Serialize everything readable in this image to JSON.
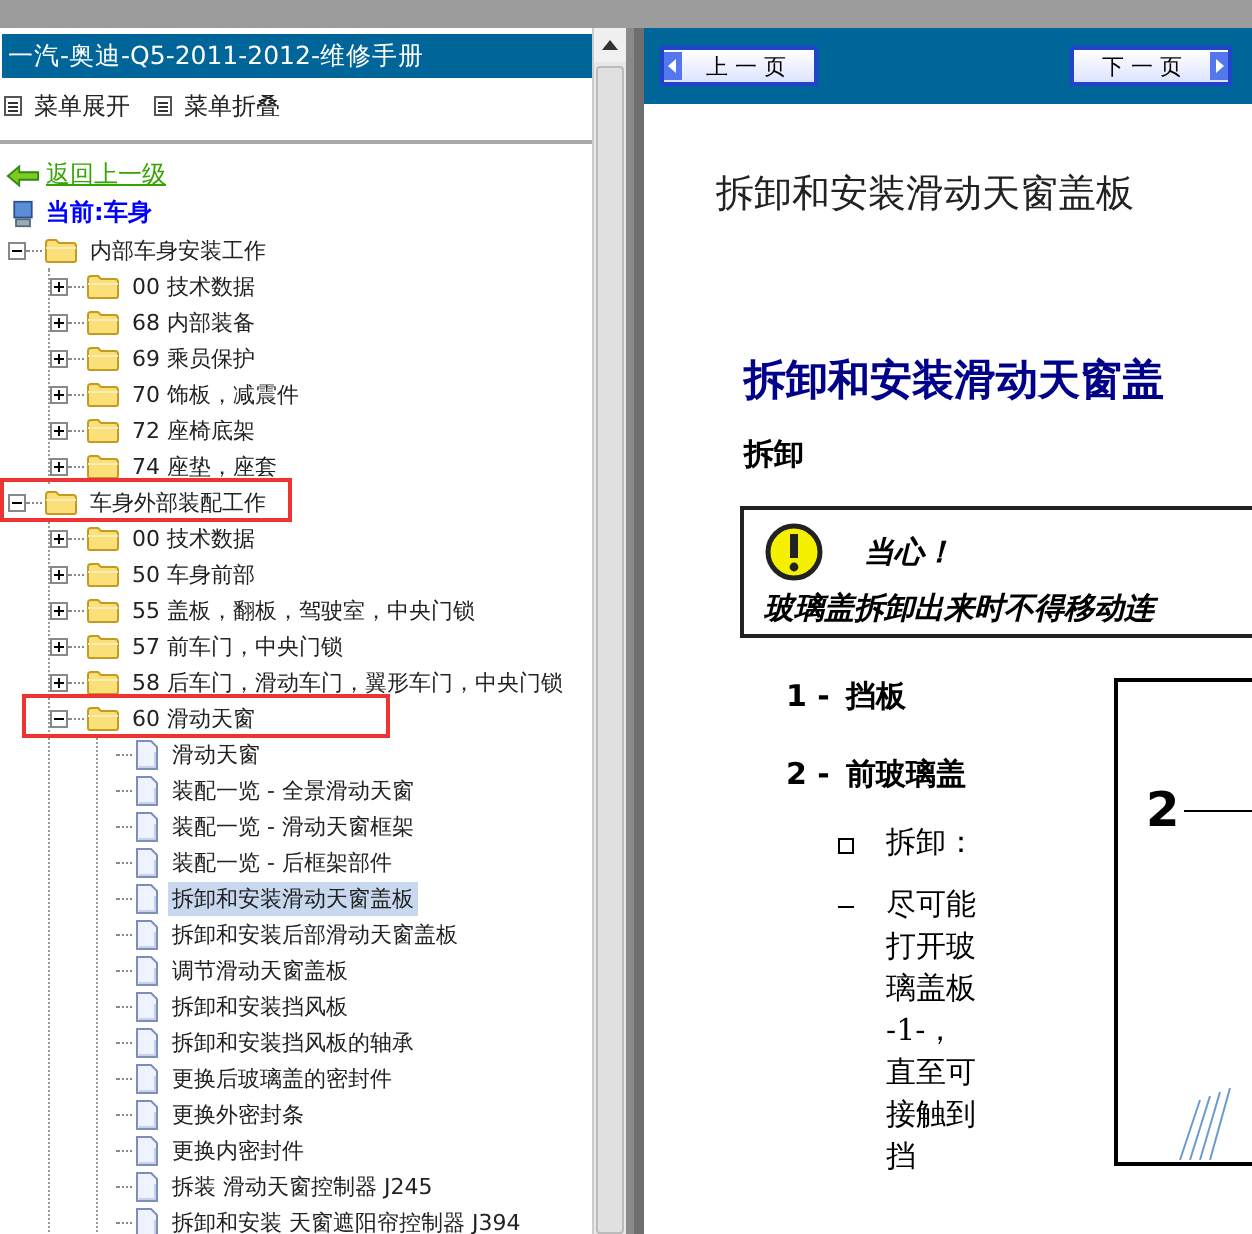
{
  "left_pane": {
    "title": "一汽-奥迪-Q5-2011-2012-维修手册",
    "menu_buttons": [
      "菜单展开",
      "菜单折叠"
    ],
    "back_link": "返回上一级",
    "current": "当前:车身",
    "tree": [
      {
        "label": "内部车身安装工作",
        "kind": "folder",
        "expanded": true,
        "selected": false,
        "annotated": false,
        "children": [
          {
            "label": "00 技术数据",
            "kind": "folder",
            "expanded": false,
            "selected": false,
            "annotated": false
          },
          {
            "label": "68 内部装备",
            "kind": "folder",
            "expanded": false,
            "selected": false,
            "annotated": false
          },
          {
            "label": "69 乘员保护",
            "kind": "folder",
            "expanded": false,
            "selected": false,
            "annotated": false
          },
          {
            "label": "70 饰板，减震件",
            "kind": "folder",
            "expanded": false,
            "selected": false,
            "annotated": false
          },
          {
            "label": "72 座椅底架",
            "kind": "folder",
            "expanded": false,
            "selected": false,
            "annotated": false
          },
          {
            "label": "74 座垫，座套",
            "kind": "folder",
            "expanded": false,
            "selected": false,
            "annotated": false
          }
        ]
      },
      {
        "label": "车身外部装配工作",
        "kind": "folder",
        "expanded": true,
        "selected": false,
        "annotated": true,
        "children": [
          {
            "label": "00 技术数据",
            "kind": "folder",
            "expanded": false,
            "selected": false,
            "annotated": false
          },
          {
            "label": "50 车身前部",
            "kind": "folder",
            "expanded": false,
            "selected": false,
            "annotated": false
          },
          {
            "label": "55 盖板，翻板，驾驶室，中央门锁",
            "kind": "folder",
            "expanded": false,
            "selected": false,
            "annotated": false
          },
          {
            "label": "57 前车门，中央门锁",
            "kind": "folder",
            "expanded": false,
            "selected": false,
            "annotated": false
          },
          {
            "label": "58 后车门，滑动车门，翼形车门，中央门锁",
            "kind": "folder",
            "expanded": false,
            "selected": false,
            "annotated": false
          },
          {
            "label": "60 滑动天窗",
            "kind": "folder",
            "expanded": true,
            "selected": false,
            "annotated": true,
            "children": [
              {
                "label": "滑动天窗",
                "kind": "page",
                "selected": false,
                "annotated": false
              },
              {
                "label": "装配一览 - 全景滑动天窗",
                "kind": "page",
                "selected": false,
                "annotated": false
              },
              {
                "label": "装配一览 - 滑动天窗框架",
                "kind": "page",
                "selected": false,
                "annotated": false
              },
              {
                "label": "装配一览 - 后框架部件",
                "kind": "page",
                "selected": false,
                "annotated": false
              },
              {
                "label": "拆卸和安装滑动天窗盖板",
                "kind": "page",
                "selected": true,
                "annotated": false
              },
              {
                "label": "拆卸和安装后部滑动天窗盖板",
                "kind": "page",
                "selected": false,
                "annotated": false
              },
              {
                "label": "调节滑动天窗盖板",
                "kind": "page",
                "selected": false,
                "annotated": false
              },
              {
                "label": "拆卸和安装挡风板",
                "kind": "page",
                "selected": false,
                "annotated": false
              },
              {
                "label": "拆卸和安装挡风板的轴承",
                "kind": "page",
                "selected": false,
                "annotated": false
              },
              {
                "label": "更换后玻璃盖的密封件",
                "kind": "page",
                "selected": false,
                "annotated": false
              },
              {
                "label": "更换外密封条",
                "kind": "page",
                "selected": false,
                "annotated": false
              },
              {
                "label": "更换内密封件",
                "kind": "page",
                "selected": false,
                "annotated": false
              },
              {
                "label": "拆装 滑动天窗控制器 J245",
                "kind": "page",
                "selected": false,
                "annotated": false
              },
              {
                "label": "拆卸和安装 天窗遮阳帘控制器 J394",
                "kind": "page",
                "selected": false,
                "annotated": false
              }
            ]
          }
        ]
      }
    ]
  },
  "right_pane": {
    "prev_button": "上 一 页",
    "next_button": "下 一 页",
    "page_title": "拆卸和安装滑动天窗盖板",
    "heading": "拆卸和安装滑动天窗盖",
    "subheading": "拆卸",
    "caution": {
      "title": "当心！",
      "text": "玻璃盖拆卸出来时不得移动连"
    },
    "parts": [
      {
        "number": "1 -",
        "name": "挡板"
      },
      {
        "number": "2 -",
        "name": "前玻璃盖"
      }
    ],
    "steps": [
      {
        "kind": "heading",
        "text": "拆卸："
      },
      {
        "kind": "action",
        "text": "尽可能打开玻璃盖板 -1-，直至可接触到挡"
      }
    ],
    "figure": {
      "callout": "2"
    }
  }
}
